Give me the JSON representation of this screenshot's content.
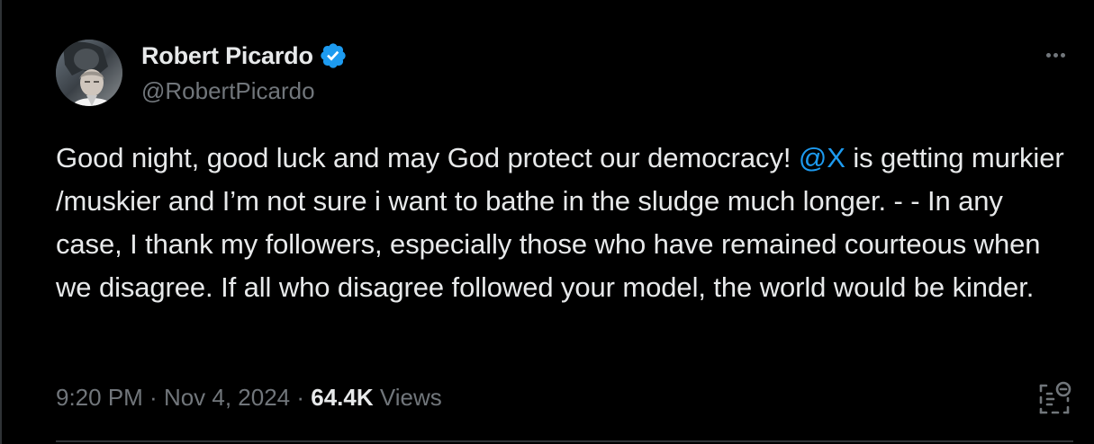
{
  "author": {
    "name": "Robert Picardo",
    "handle": "@RobertPicardo",
    "verified": true,
    "avatar_icon": "profile-photo"
  },
  "tweet": {
    "segment_1": "Good night, good luck  and may God protect our democracy! ",
    "mention": "@X",
    "segment_2": " is getting murkier /muskier and I’m not sure i want to bathe in the sludge much longer. - - In any case, I thank my followers, especially those who have remained courteous when we disagree. If all who disagree followed your model, the world would be kinder."
  },
  "meta": {
    "time": "9:20 PM",
    "separator": " · ",
    "date": "Nov 4, 2024",
    "views_count": "64.4K",
    "views_label": " Views"
  },
  "icons": {
    "more": "more-options-icon",
    "verified": "verified-badge-icon",
    "analytics": "post-analytics-icon"
  },
  "colors": {
    "background": "#000000",
    "text": "#e7e9ea",
    "secondary_text": "#71767b",
    "accent": "#1d9bf0",
    "divider": "#2f3336"
  }
}
